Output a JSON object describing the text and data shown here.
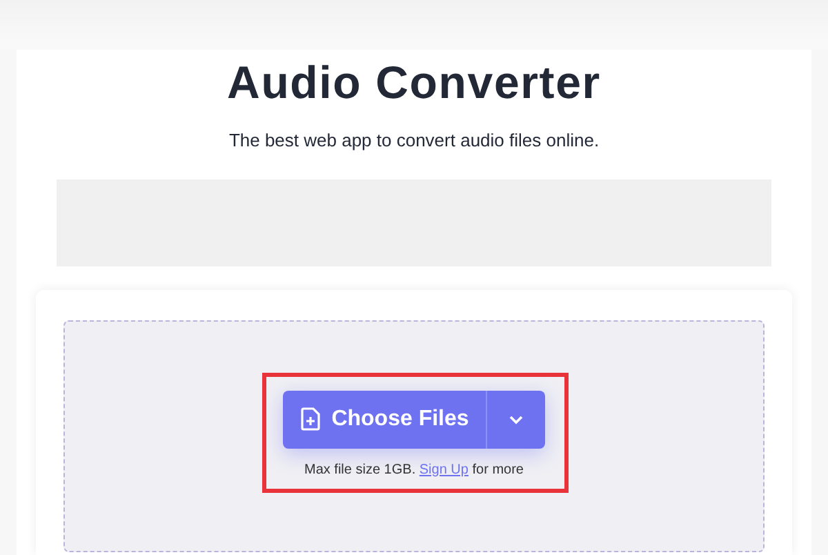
{
  "title": "Audio Converter",
  "subtitle": "The best web app to convert audio files online.",
  "upload": {
    "button": "Choose Files",
    "note_before": "Max file size 1GB.",
    "link": "Sign Up",
    "note_after": "for more",
    "highlighted": true
  }
}
